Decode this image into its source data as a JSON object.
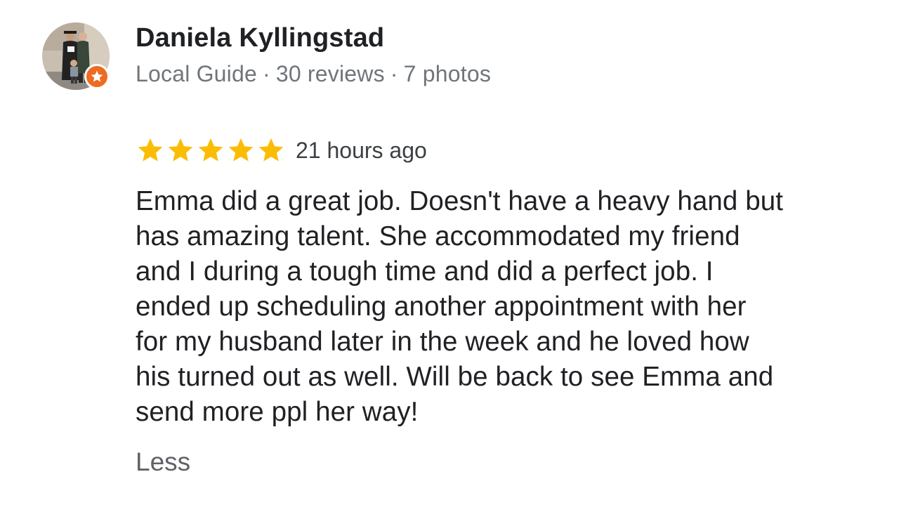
{
  "reviewer": {
    "name": "Daniela Kyllingstad",
    "badge_label": "Local Guide",
    "separator": "·",
    "reviews_count": "30 reviews",
    "photos_count": "7 photos",
    "avatar_icon": "profile-photo",
    "badge_icon": "local-guide-star-icon",
    "badge_color": "#ee6b22"
  },
  "review": {
    "rating": 5,
    "rating_max": 5,
    "star_color": "#fbbc04",
    "time_ago": "21 hours ago",
    "text_lines": [
      "Emma did a great job. Doesn't have a heavy hand but",
      "has amazing talent. She accommodated my friend",
      "and I during a tough time and did a perfect job. I",
      "ended up scheduling another appointment with her",
      "for my husband later in the week and he loved how",
      "his turned out as well. Will be back to see Emma and",
      "send more ppl her way!"
    ],
    "collapse_label": "Less"
  }
}
